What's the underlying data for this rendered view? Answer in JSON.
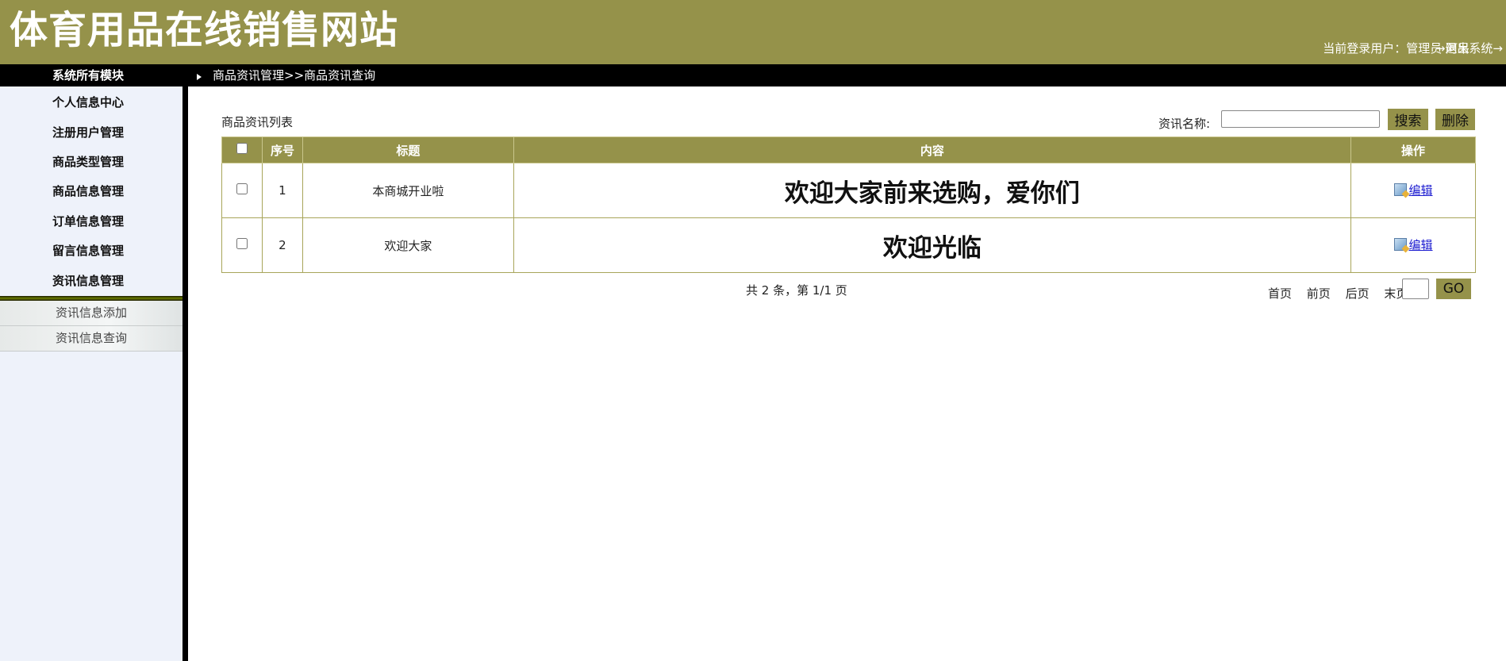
{
  "header": {
    "site_title": "体育用品在线销售网站",
    "login_info": "当前登录用户：管理员 阿呆",
    "logout": "→退出系统→"
  },
  "nav": {
    "module_title": "系统所有模块",
    "breadcrumb": "商品资讯管理>>商品资讯查询"
  },
  "sidebar": {
    "items": [
      {
        "label": "个人信息中心"
      },
      {
        "label": "注册用户管理"
      },
      {
        "label": "商品类型管理"
      },
      {
        "label": "商品信息管理"
      },
      {
        "label": "订单信息管理"
      },
      {
        "label": "留言信息管理"
      },
      {
        "label": "资讯信息管理"
      }
    ],
    "submenu": [
      {
        "label": "资讯信息添加"
      },
      {
        "label": "资讯信息查询"
      }
    ]
  },
  "main": {
    "list_title": "商品资讯列表",
    "search": {
      "label": "资讯名称:",
      "value": "",
      "placeholder": "",
      "search_button": "搜索",
      "delete_button": "删除"
    },
    "table": {
      "headers": [
        "序号",
        "标题",
        "内容",
        "操作"
      ],
      "rows": [
        {
          "index": "1",
          "title": "本商城开业啦",
          "content": "欢迎大家前来选购，爱你们",
          "action": "编辑"
        },
        {
          "index": "2",
          "title": "欢迎大家",
          "content": "欢迎光临",
          "action": "编辑"
        }
      ]
    },
    "pagination": {
      "info": "共 2 条，第 1/1 页",
      "first": "首页",
      "prev": "前页",
      "next": "后页",
      "last": "末页",
      "go_button": "GO"
    }
  },
  "colors": {
    "accent": "#95924a",
    "navbar": "#000000",
    "sidebar": "#eef2fa"
  }
}
